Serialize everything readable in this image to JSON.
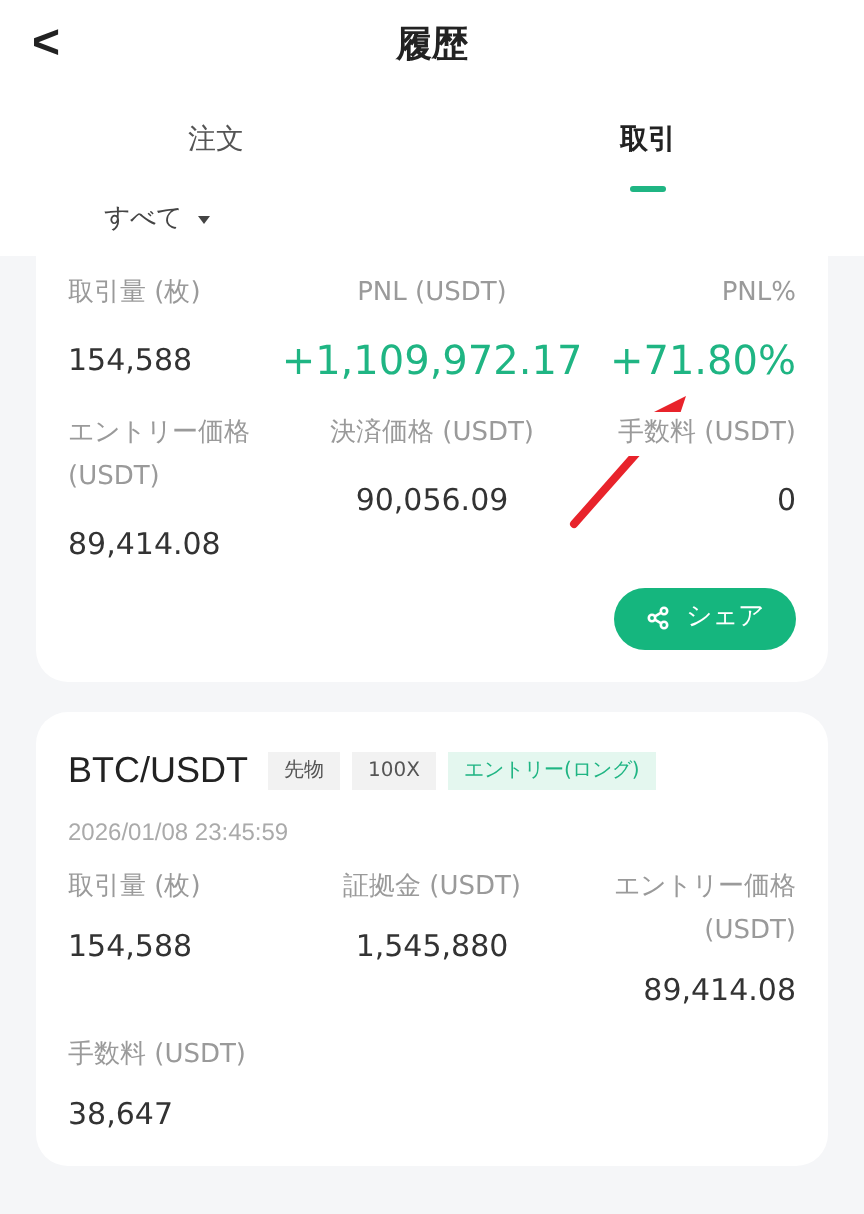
{
  "header": {
    "back": "<",
    "title": "履歴"
  },
  "tabs": [
    {
      "label": "注文",
      "selected": false
    },
    {
      "label": "取引",
      "selected": true
    }
  ],
  "filter": {
    "label": "すべて"
  },
  "trade_card": {
    "fields": [
      {
        "label": "取引量 (枚)",
        "value": "154,588",
        "kind": "plain"
      },
      {
        "label": "PNL (USDT)",
        "value": "+1,109,972.17",
        "kind": "profit"
      },
      {
        "label": "PNL%",
        "value": "+71.80%",
        "kind": "profit"
      },
      {
        "label": "エントリー価格 (USDT)",
        "value": "89,414.08",
        "kind": "plain"
      },
      {
        "label": "決済価格 (USDT)",
        "value": "90,056.09",
        "kind": "plain"
      },
      {
        "label": "手数料 (USDT)",
        "value": "0",
        "kind": "plain"
      }
    ],
    "share": "シェア"
  },
  "order_card": {
    "pair": "BTC/USDT",
    "tags": [
      {
        "text": "先物",
        "kind": "neutral"
      },
      {
        "text": "100X",
        "kind": "neutral"
      },
      {
        "text": "エントリー(ロング)",
        "kind": "accent"
      }
    ],
    "time": "2026/01/08 23:45:59",
    "fields": [
      {
        "label": "取引量 (枚)",
        "value": "154,588"
      },
      {
        "label": "証拠金 (USDT)",
        "value": "1,545,880"
      },
      {
        "label": "エントリー価格 (USDT)",
        "value": "89,414.08"
      },
      {
        "label": "手数料 (USDT)",
        "value": "38,647"
      }
    ]
  }
}
